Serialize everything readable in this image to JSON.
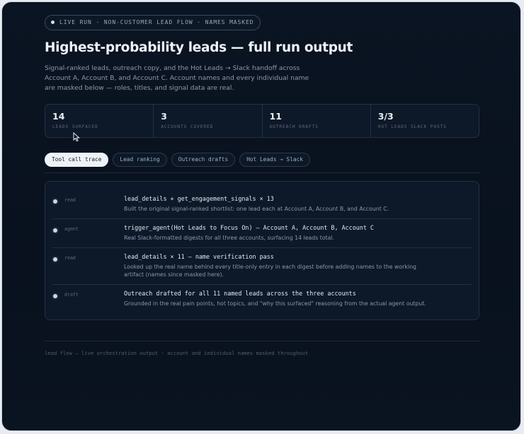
{
  "badge": {
    "label": "LIVE RUN · NON-CUSTOMER LEAD FLOW · NAMES MASKED"
  },
  "header": {
    "title": "Highest-probability leads — full run output",
    "subtitle": "Signal-ranked leads, outreach copy, and the Hot Leads → Slack handoff across Account A, Account B, and Account C. Account names and every individual name are masked below — roles, titles, and signal data are real."
  },
  "stats": [
    {
      "value": "14",
      "label": "LEADS SURFACED"
    },
    {
      "value": "3",
      "label": "ACCOUNTS COVERED"
    },
    {
      "value": "11",
      "label": "OUTREACH DRAFTS"
    },
    {
      "value": "3/3",
      "label": "HOT LEADS SLACK POSTS"
    }
  ],
  "tabs": [
    {
      "label": "Tool call trace",
      "active": true
    },
    {
      "label": "Lead ranking",
      "active": false
    },
    {
      "label": "Outreach drafts",
      "active": false
    },
    {
      "label": "Hot Leads → Slack",
      "active": false
    }
  ],
  "trace": [
    {
      "kind": "read",
      "title": "lead_details + get_engagement_signals × 13",
      "desc": "Built the original signal-ranked shortlist: one lead each at Account A, Account B, and Account C."
    },
    {
      "kind": "agent",
      "title": "trigger_agent(Hot Leads to Focus On) — Account A, Account B, Account C",
      "desc": "Real Slack-formatted digests for all three accounts, surfacing 14 leads total."
    },
    {
      "kind": "read",
      "title": "lead_details × 11 — name verification pass",
      "desc": "Looked up the real name behind every title-only entry in each digest before adding names to the working artifact (names since masked here)."
    },
    {
      "kind": "draft",
      "title": "Outreach drafted for all 11 named leads across the three accounts",
      "desc": "Grounded in the real pain points, hot topics, and \"why this surfaced\" reasoning from the actual agent output."
    }
  ],
  "footer": {
    "text": "lead flow — live orchestration output · account and individual names masked throughout"
  }
}
